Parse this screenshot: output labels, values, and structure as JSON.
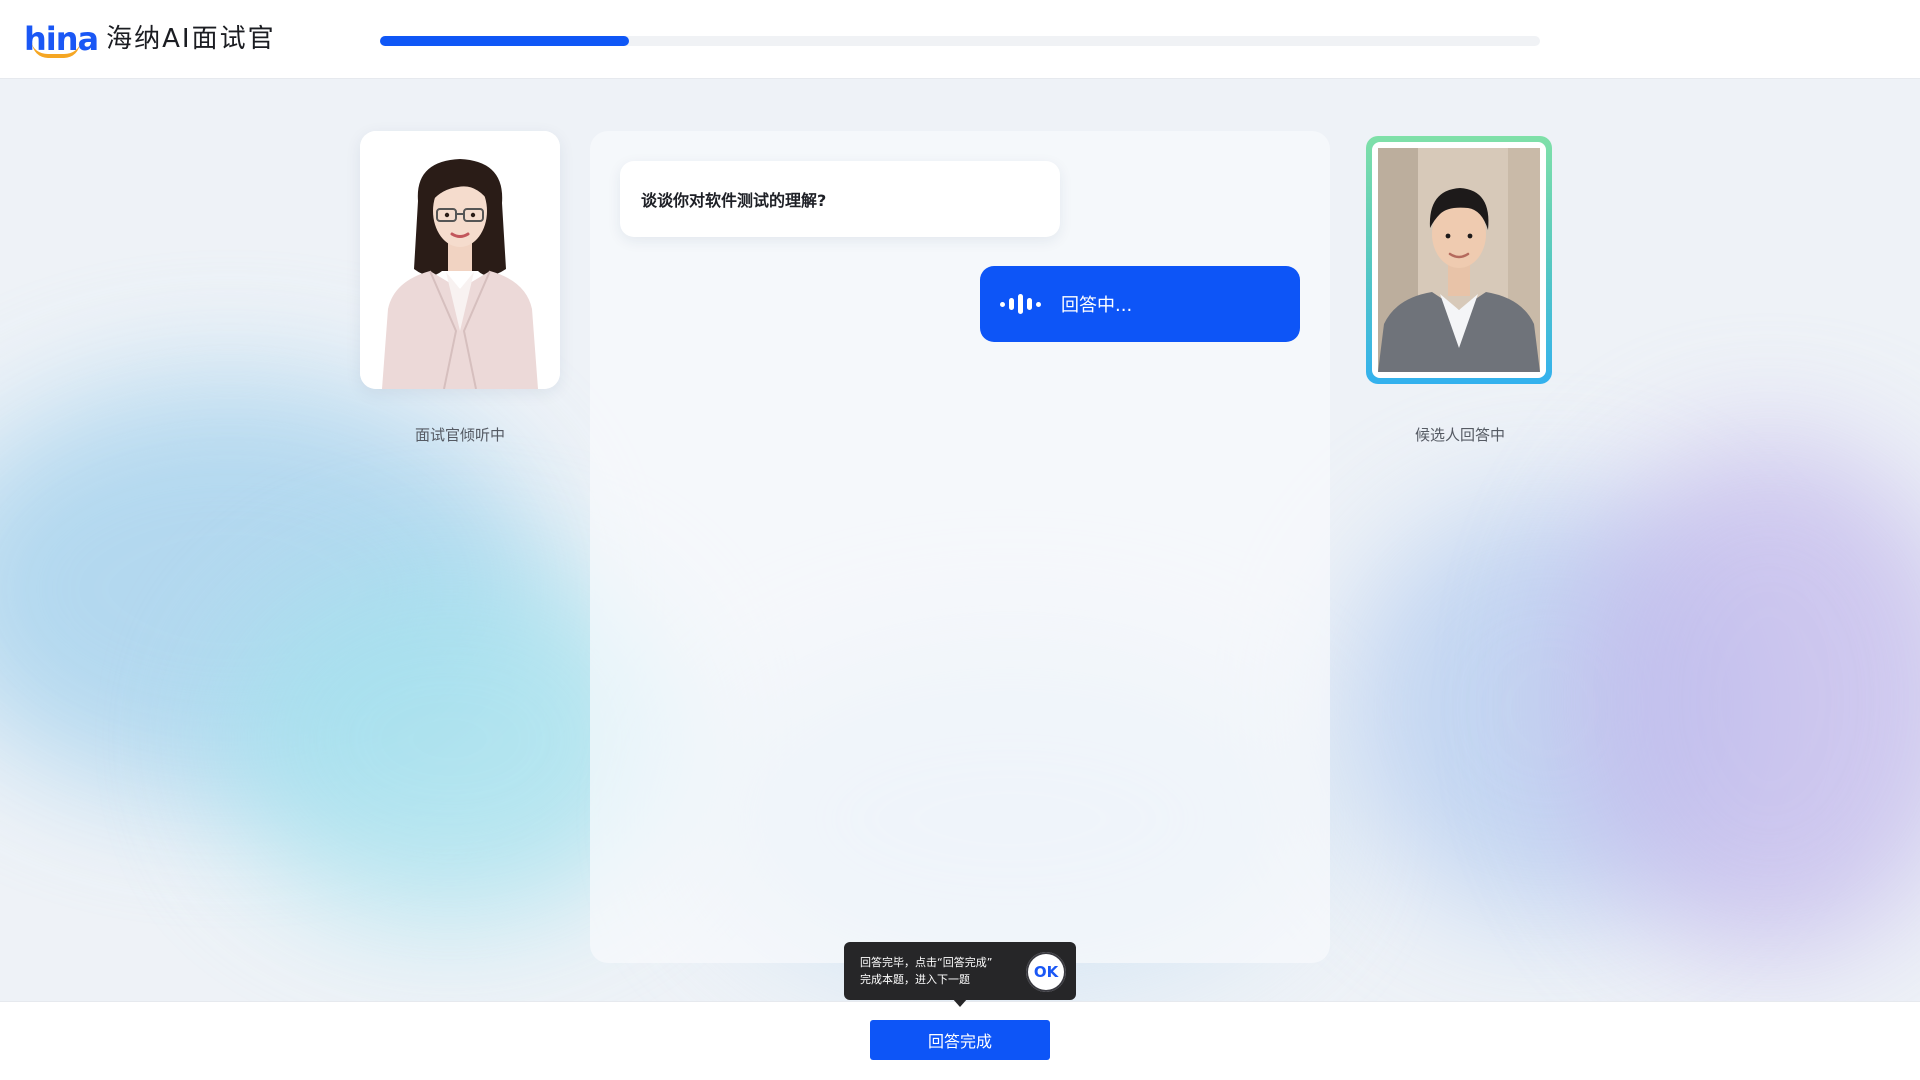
{
  "header": {
    "logo_mark": "hina",
    "logo_text": "海纳AI面试官",
    "progress_fraction": 0.215
  },
  "interviewer": {
    "caption": "面试官倾听中"
  },
  "candidate": {
    "caption": "候选人回答中"
  },
  "chat": {
    "question": "谈谈你对软件测试的理解?",
    "answer_status": "回答中..."
  },
  "tooltip": {
    "text_line1": "回答完毕，点击“回答完成”",
    "text_line2": "完成本题，进入下一题",
    "ok_label": "OK"
  },
  "footer": {
    "done_label": "回答完成"
  },
  "colors": {
    "primary": "#0d55f7",
    "frame_gradient_top": "#7fe0a8",
    "frame_gradient_bottom": "#33b1ee"
  }
}
